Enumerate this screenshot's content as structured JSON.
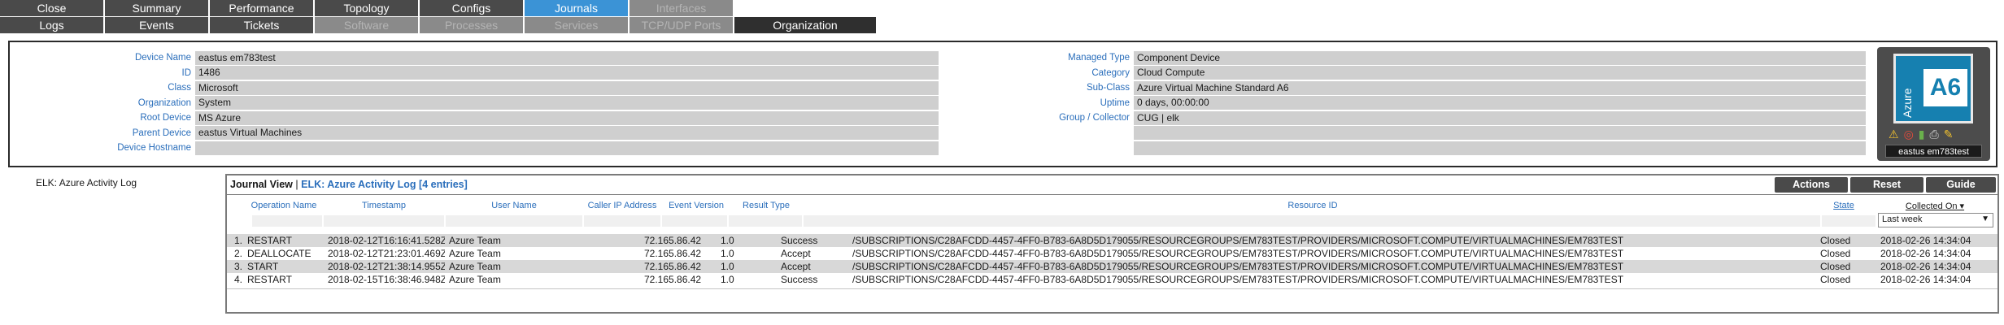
{
  "tabs_row1": [
    {
      "label": "Close",
      "state": "normal"
    },
    {
      "label": "Summary",
      "state": "normal"
    },
    {
      "label": "Performance",
      "state": "normal"
    },
    {
      "label": "Topology",
      "state": "normal"
    },
    {
      "label": "Configs",
      "state": "normal"
    },
    {
      "label": "Journals",
      "state": "active"
    },
    {
      "label": "Interfaces",
      "state": "disabled"
    }
  ],
  "tabs_row2": [
    {
      "label": "Logs",
      "state": "normal"
    },
    {
      "label": "Events",
      "state": "normal"
    },
    {
      "label": "Tickets",
      "state": "normal"
    },
    {
      "label": "Software",
      "state": "disabled"
    },
    {
      "label": "Processes",
      "state": "disabled"
    },
    {
      "label": "Services",
      "state": "disabled"
    },
    {
      "label": "TCP/UDP Ports",
      "state": "disabled"
    },
    {
      "label": "Organization",
      "state": "org"
    }
  ],
  "device": {
    "left": [
      {
        "label": "Device Name",
        "value": "eastus em783test"
      },
      {
        "label": "ID",
        "value": "1486"
      },
      {
        "label": "Class",
        "value": "Microsoft"
      },
      {
        "label": "Organization",
        "value": "System"
      },
      {
        "label": "Root Device",
        "value": "MS Azure"
      },
      {
        "label": "Parent Device",
        "value": "eastus Virtual Machines"
      },
      {
        "label": "Device Hostname",
        "value": ""
      }
    ],
    "right": [
      {
        "label": "Managed Type",
        "value": "Component Device"
      },
      {
        "label": "Category",
        "value": "Cloud Compute"
      },
      {
        "label": "Sub-Class",
        "value": "Azure Virtual Machine Standard A6"
      },
      {
        "label": "Uptime",
        "value": "0 days, 00:00:00"
      },
      {
        "label": "Group / Collector",
        "value": "CUG | elk"
      },
      {
        "label": "",
        "value": ""
      },
      {
        "label": "",
        "value": ""
      }
    ],
    "card": {
      "logo_vertical_text": "Azure",
      "logo_text": "A6",
      "name": "eastus em783test",
      "icons": [
        "warning-icon",
        "lifebuoy-icon",
        "bar-chart-icon",
        "printer-icon",
        "wrench-icon"
      ]
    }
  },
  "left_caption": "ELK: Azure Activity Log",
  "journal": {
    "view_label": "Journal View",
    "separator": "|",
    "subtitle": "ELK: Azure Activity Log [4 entries]",
    "buttons": {
      "actions": "Actions",
      "reset": "Reset",
      "guide": "Guide"
    },
    "columns": {
      "operation": "Operation Name",
      "timestamp": "Timestamp",
      "user": "User Name",
      "caller_ip": "Caller IP Address",
      "event_version": "Event Version",
      "result_type": "Result Type",
      "resource_id": "Resource ID",
      "state": "State",
      "collected_on": "Collected On ▾"
    },
    "filter_collected_on": "Last week",
    "rows": [
      {
        "num": "1.",
        "operation": "RESTART",
        "timestamp": "2018-02-12T16:16:41.528Z",
        "user": "Azure Team",
        "ip": "72.165.86.42",
        "ver": "1.0",
        "result": "Success",
        "resource": "/SUBSCRIPTIONS/C28AFCDD-4457-4FF0-B783-6A8D5D179055/RESOURCEGROUPS/EM783TEST/PROVIDERS/MICROSOFT.COMPUTE/VIRTUALMACHINES/EM783TEST",
        "state": "Closed",
        "collected": "2018-02-26 14:34:04"
      },
      {
        "num": "2.",
        "operation": "DEALLOCATE",
        "timestamp": "2018-02-12T21:23:01.469Z",
        "user": "Azure Team",
        "ip": "72.165.86.42",
        "ver": "1.0",
        "result": "Accept",
        "resource": "/SUBSCRIPTIONS/C28AFCDD-4457-4FF0-B783-6A8D5D179055/RESOURCEGROUPS/EM783TEST/PROVIDERS/MICROSOFT.COMPUTE/VIRTUALMACHINES/EM783TEST",
        "state": "Closed",
        "collected": "2018-02-26 14:34:04"
      },
      {
        "num": "3.",
        "operation": "START",
        "timestamp": "2018-02-12T21:38:14.955Z",
        "user": "Azure Team",
        "ip": "72.165.86.42",
        "ver": "1.0",
        "result": "Accept",
        "resource": "/SUBSCRIPTIONS/C28AFCDD-4457-4FF0-B783-6A8D5D179055/RESOURCEGROUPS/EM783TEST/PROVIDERS/MICROSOFT.COMPUTE/VIRTUALMACHINES/EM783TEST",
        "state": "Closed",
        "collected": "2018-02-26 14:34:04"
      },
      {
        "num": "4.",
        "operation": "RESTART",
        "timestamp": "2018-02-15T16:38:46.948Z",
        "user": "Azure Team",
        "ip": "72.165.86.42",
        "ver": "1.0",
        "result": "Success",
        "resource": "/SUBSCRIPTIONS/C28AFCDD-4457-4FF0-B783-6A8D5D179055/RESOURCEGROUPS/EM783TEST/PROVIDERS/MICROSOFT.COMPUTE/VIRTUALMACHINES/EM783TEST",
        "state": "Closed",
        "collected": "2018-02-26 14:34:04"
      }
    ]
  },
  "colors": {
    "tab": "#4a4a4a",
    "tab_active": "#3b93d6",
    "tab_disabled": "#8a8a8a",
    "label_blue": "#2a6ebb",
    "azure_blue": "#1680b0"
  }
}
